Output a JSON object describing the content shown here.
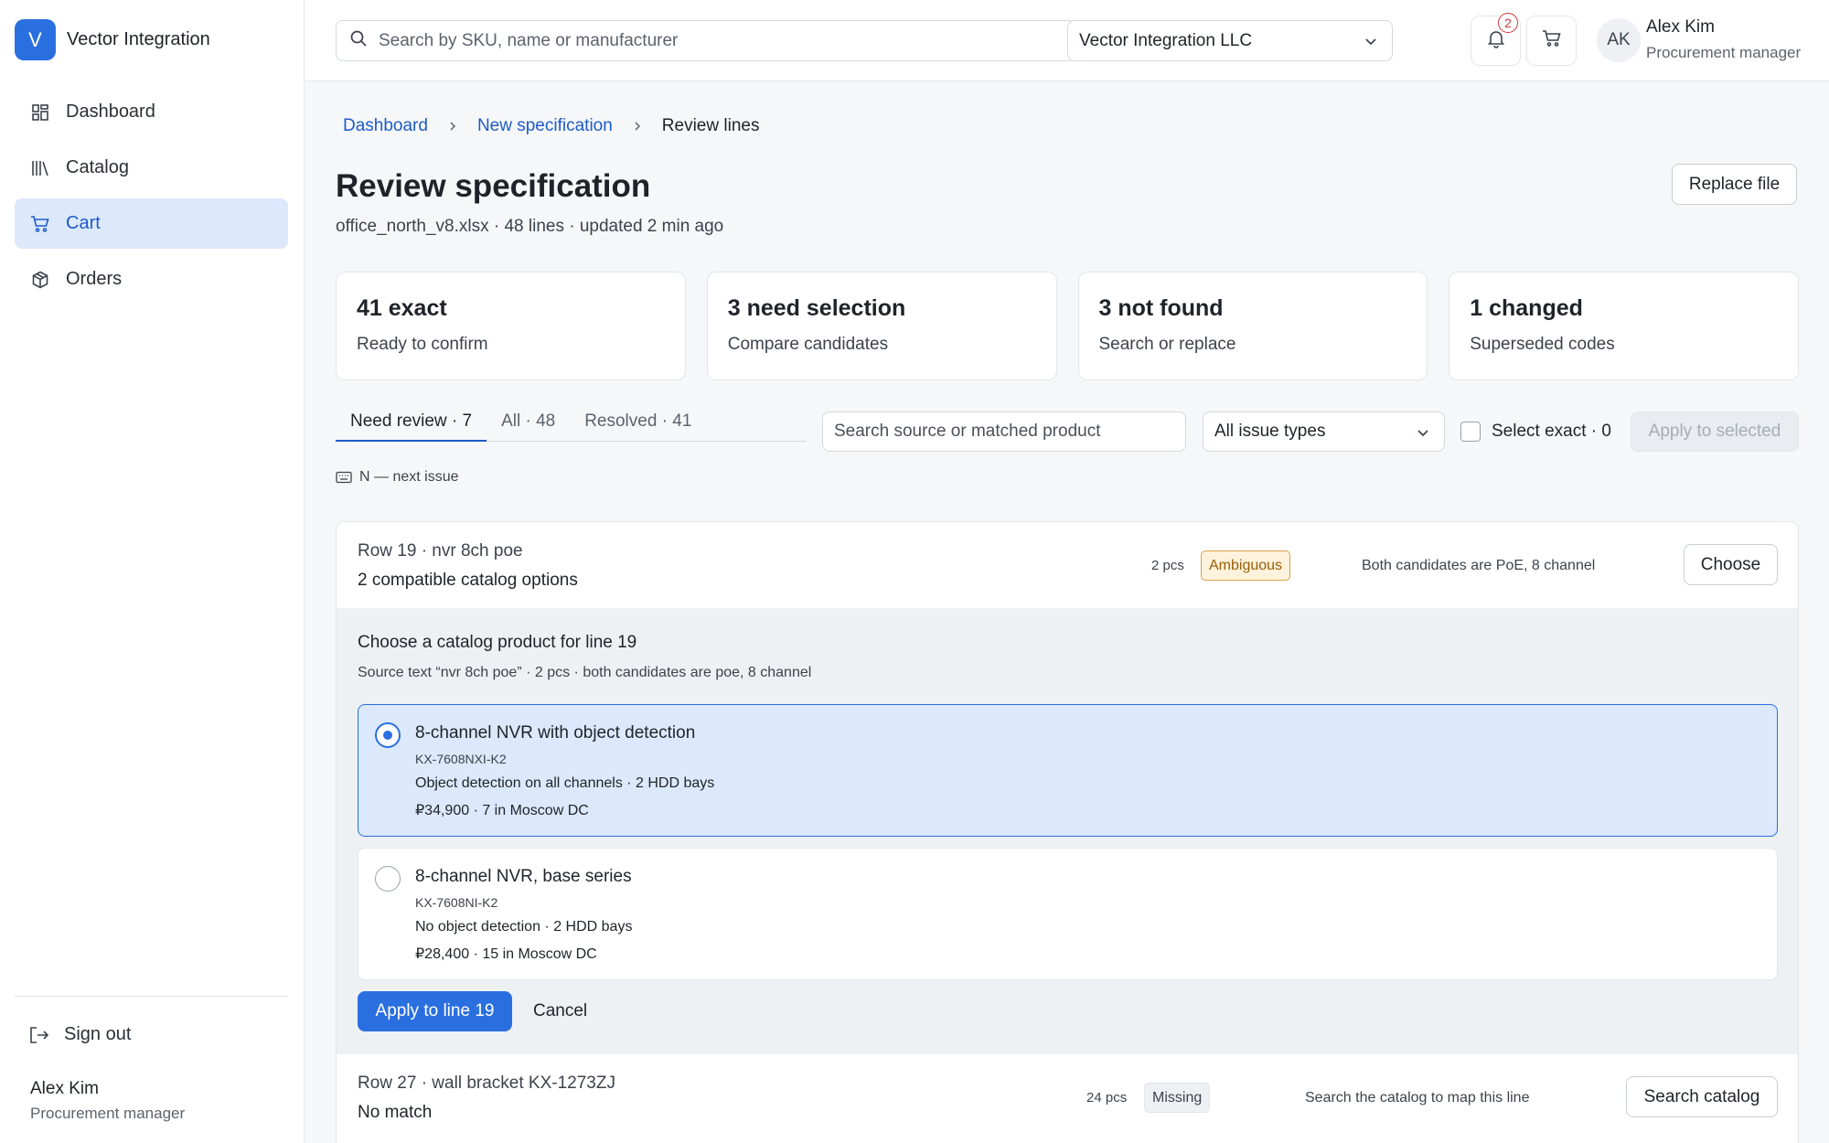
{
  "brand": {
    "logo_letter": "V",
    "name": "Vector Integration"
  },
  "sidebar": {
    "items": [
      {
        "label": "Dashboard",
        "icon": "dashboard-grid-icon"
      },
      {
        "label": "Catalog",
        "icon": "books-icon"
      },
      {
        "label": "Cart",
        "icon": "cart-icon",
        "active": true
      },
      {
        "label": "Orders",
        "icon": "package-icon"
      }
    ],
    "signout": "Sign out",
    "user": {
      "name": "Alex Kim",
      "role": "Procurement manager"
    }
  },
  "topbar": {
    "search_placeholder": "Search by SKU, name or manufacturer",
    "company": "Vector Integration LLC",
    "notification_count": "2",
    "user": {
      "initials": "AK",
      "name": "Alex Kim",
      "role": "Procurement manager"
    }
  },
  "breadcrumb": {
    "items": [
      "Dashboard",
      "New specification"
    ],
    "current": "Review lines"
  },
  "page": {
    "title": "Review specification",
    "subtitle": "office_north_v8.xlsx · 48 lines · updated 2 min ago",
    "replace_button": "Replace file"
  },
  "summary": [
    {
      "title": "41 exact",
      "sub": "Ready to confirm"
    },
    {
      "title": "3 need selection",
      "sub": "Compare candidates"
    },
    {
      "title": "3 not found",
      "sub": "Search or replace"
    },
    {
      "title": "1 changed",
      "sub": "Superseded codes"
    }
  ],
  "tabs": [
    {
      "label": "Need review · 7",
      "active": true
    },
    {
      "label": "All · 48"
    },
    {
      "label": "Resolved · 41"
    }
  ],
  "filters": {
    "search_placeholder": "Search source or matched product",
    "issue_type": "All issue types",
    "select_exact": "Select exact · 0",
    "apply_selected": "Apply to selected"
  },
  "shortcut_hint": "N — next issue",
  "issues": [
    {
      "title": "Row 19 · nvr 8ch poe",
      "sub": "2 compatible catalog options",
      "qty": "2 pcs",
      "status": "Ambiguous",
      "note": "Both candidates are PoE, 8 channel",
      "action": "Choose",
      "expanded": {
        "heading": "Choose a catalog product for line 19",
        "source": "Source text “nvr 8ch poe” · 2 pcs · both candidates are poe, 8 channel",
        "options": [
          {
            "name": "8-channel NVR with object detection",
            "sku": "KX-7608NXI-K2",
            "desc": "Object detection on all channels · 2 HDD bays",
            "price": "₽34,900 · 7 in Moscow DC",
            "selected": true
          },
          {
            "name": "8-channel NVR, base series",
            "sku": "KX-7608NI-K2",
            "desc": "No object detection · 2 HDD bays",
            "price": "₽28,400 · 15 in Moscow DC",
            "selected": false
          }
        ],
        "apply": "Apply to line 19",
        "cancel": "Cancel"
      }
    },
    {
      "title": "Row 27 · wall bracket KX-1273ZJ",
      "sub": "No match",
      "qty": "24 pcs",
      "status": "Missing",
      "note": "Search the catalog to map this line",
      "action": "Search catalog"
    }
  ],
  "colors": {
    "accent": "#2a6fe0",
    "active_nav_bg": "#dce8fb",
    "ambiguous": "#d9a14a",
    "alert": "#d03a3a"
  }
}
